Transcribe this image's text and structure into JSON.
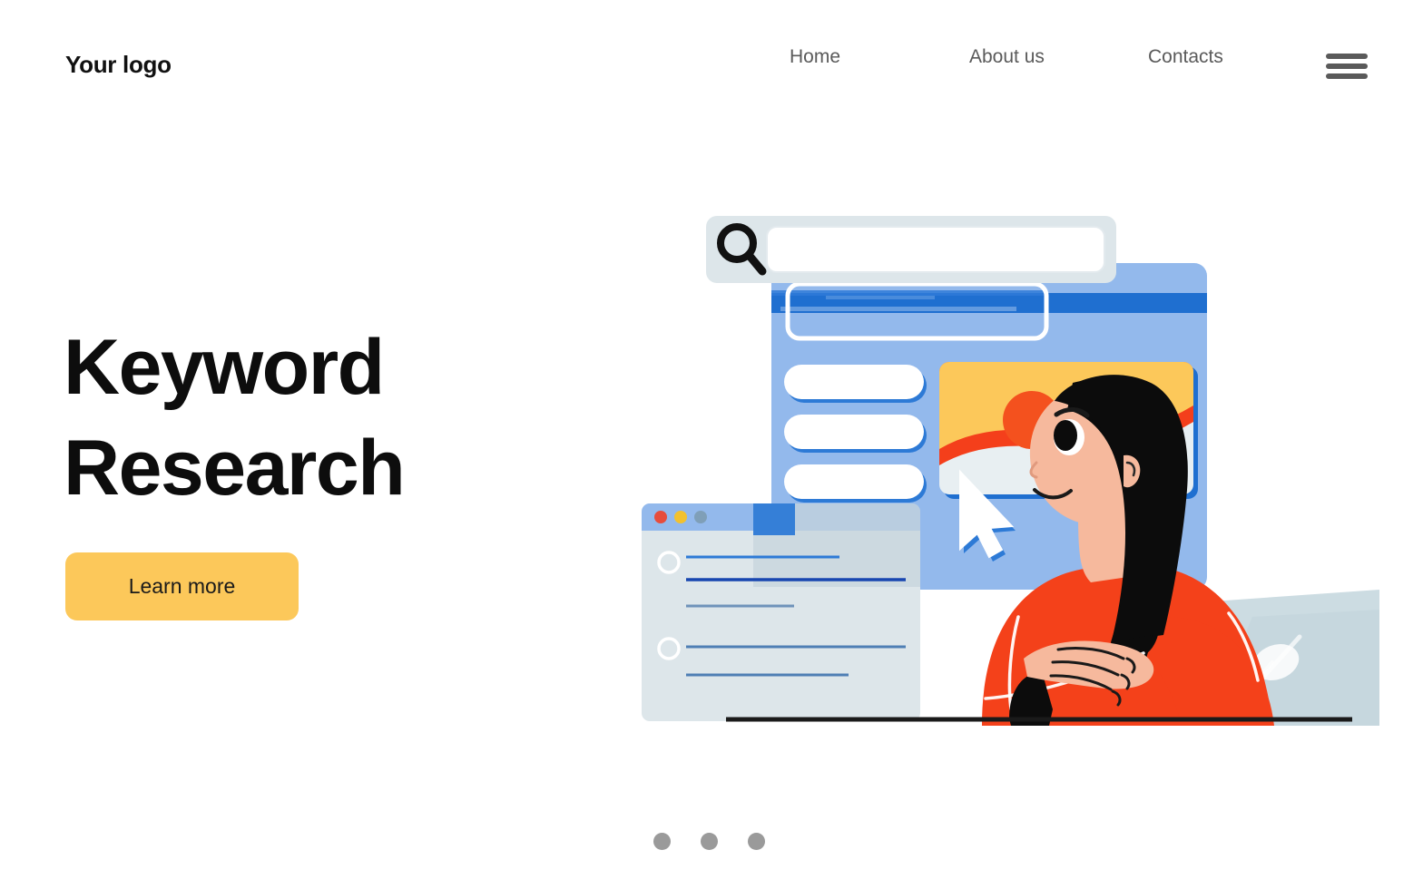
{
  "header": {
    "logo": "Your logo",
    "nav": [
      {
        "label": "Home"
      },
      {
        "label": "About us"
      },
      {
        "label": "Contacts"
      }
    ],
    "menu_icon": "hamburger-menu-icon"
  },
  "hero": {
    "title_line1": "Keyword",
    "title_line2": "Research",
    "cta_label": "Learn more"
  },
  "carousel": {
    "dots": [
      {
        "index": "1",
        "active": "false"
      },
      {
        "index": "2",
        "active": "false"
      },
      {
        "index": "3",
        "active": "false"
      }
    ]
  },
  "illustration": {
    "description": "Woman in red sweater at laptop looking at floating search UI cards",
    "search_bar": {
      "icon": "magnifier-icon",
      "input_value": "",
      "placeholder": ""
    },
    "browser_window": {
      "traffic_lights": [
        "red",
        "yellow",
        "gray-blue"
      ],
      "list_rows": 2
    },
    "result_card": {
      "rows": 3,
      "thumbnail": "sunset-landscape-thumbnail"
    },
    "cursor": "mouse-pointer-icon",
    "mug": "tea-mug-icon",
    "laptop": "laptop-icon"
  },
  "colors": {
    "accent_yellow": "#fcc85a",
    "accent_red": "#f43f1b",
    "accent_orange": "#f96d1b",
    "blue_light": "#93b9ec",
    "blue_mid": "#1f6fd0",
    "blue_dark": "#1457b0",
    "panel_gray": "#dde6ea",
    "text_dark": "#0d0d0d",
    "text_muted": "#5a5a5a",
    "dot_gray": "#9a9a9a",
    "skin": "#f6b99d",
    "hair_black": "#0c0c0c",
    "laptop_gray": "#ccdce2"
  }
}
